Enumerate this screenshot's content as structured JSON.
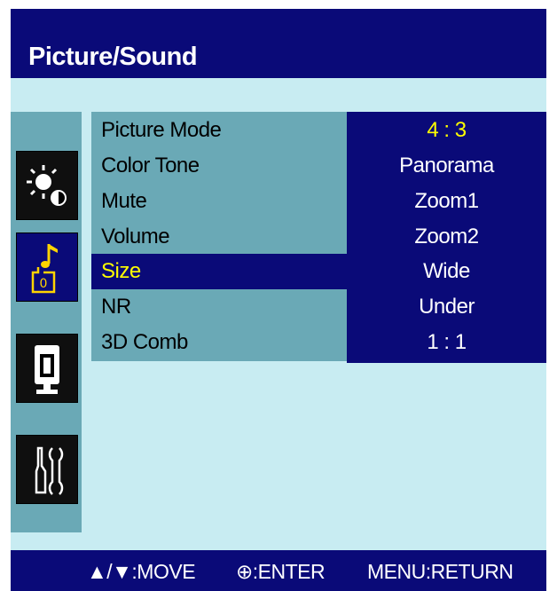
{
  "header": {
    "title": "Picture/Sound"
  },
  "sidebar": {
    "icons": [
      {
        "name": "picture-brightness-icon",
        "active": false
      },
      {
        "name": "sound-note-icon",
        "active": true
      },
      {
        "name": "monitor-display-icon",
        "active": false
      },
      {
        "name": "setup-tools-icon",
        "active": false
      }
    ]
  },
  "menu": {
    "items": [
      {
        "label": "Picture Mode",
        "selected": false
      },
      {
        "label": "Color Tone",
        "selected": false
      },
      {
        "label": "Mute",
        "selected": false
      },
      {
        "label": "Volume",
        "selected": false
      },
      {
        "label": "Size",
        "selected": true
      },
      {
        "label": "NR",
        "selected": false
      },
      {
        "label": "3D Comb",
        "selected": false
      }
    ]
  },
  "options": {
    "items": [
      {
        "label": "4 : 3",
        "selected": true
      },
      {
        "label": "Panorama",
        "selected": false
      },
      {
        "label": "Zoom1",
        "selected": false
      },
      {
        "label": "Zoom2",
        "selected": false
      },
      {
        "label": "Wide",
        "selected": false
      },
      {
        "label": "Under",
        "selected": false
      },
      {
        "label": "1 : 1",
        "selected": false
      }
    ]
  },
  "footer": {
    "move": "▲/▼:MOVE",
    "enter": "⊕:ENTER",
    "return": "MENU:RETURN"
  },
  "colors": {
    "panel_bg": "#c8ecf2",
    "bar_blue": "#0a0a78",
    "menu_teal": "#6aa9b6",
    "highlight_yellow": "#ffff00"
  }
}
